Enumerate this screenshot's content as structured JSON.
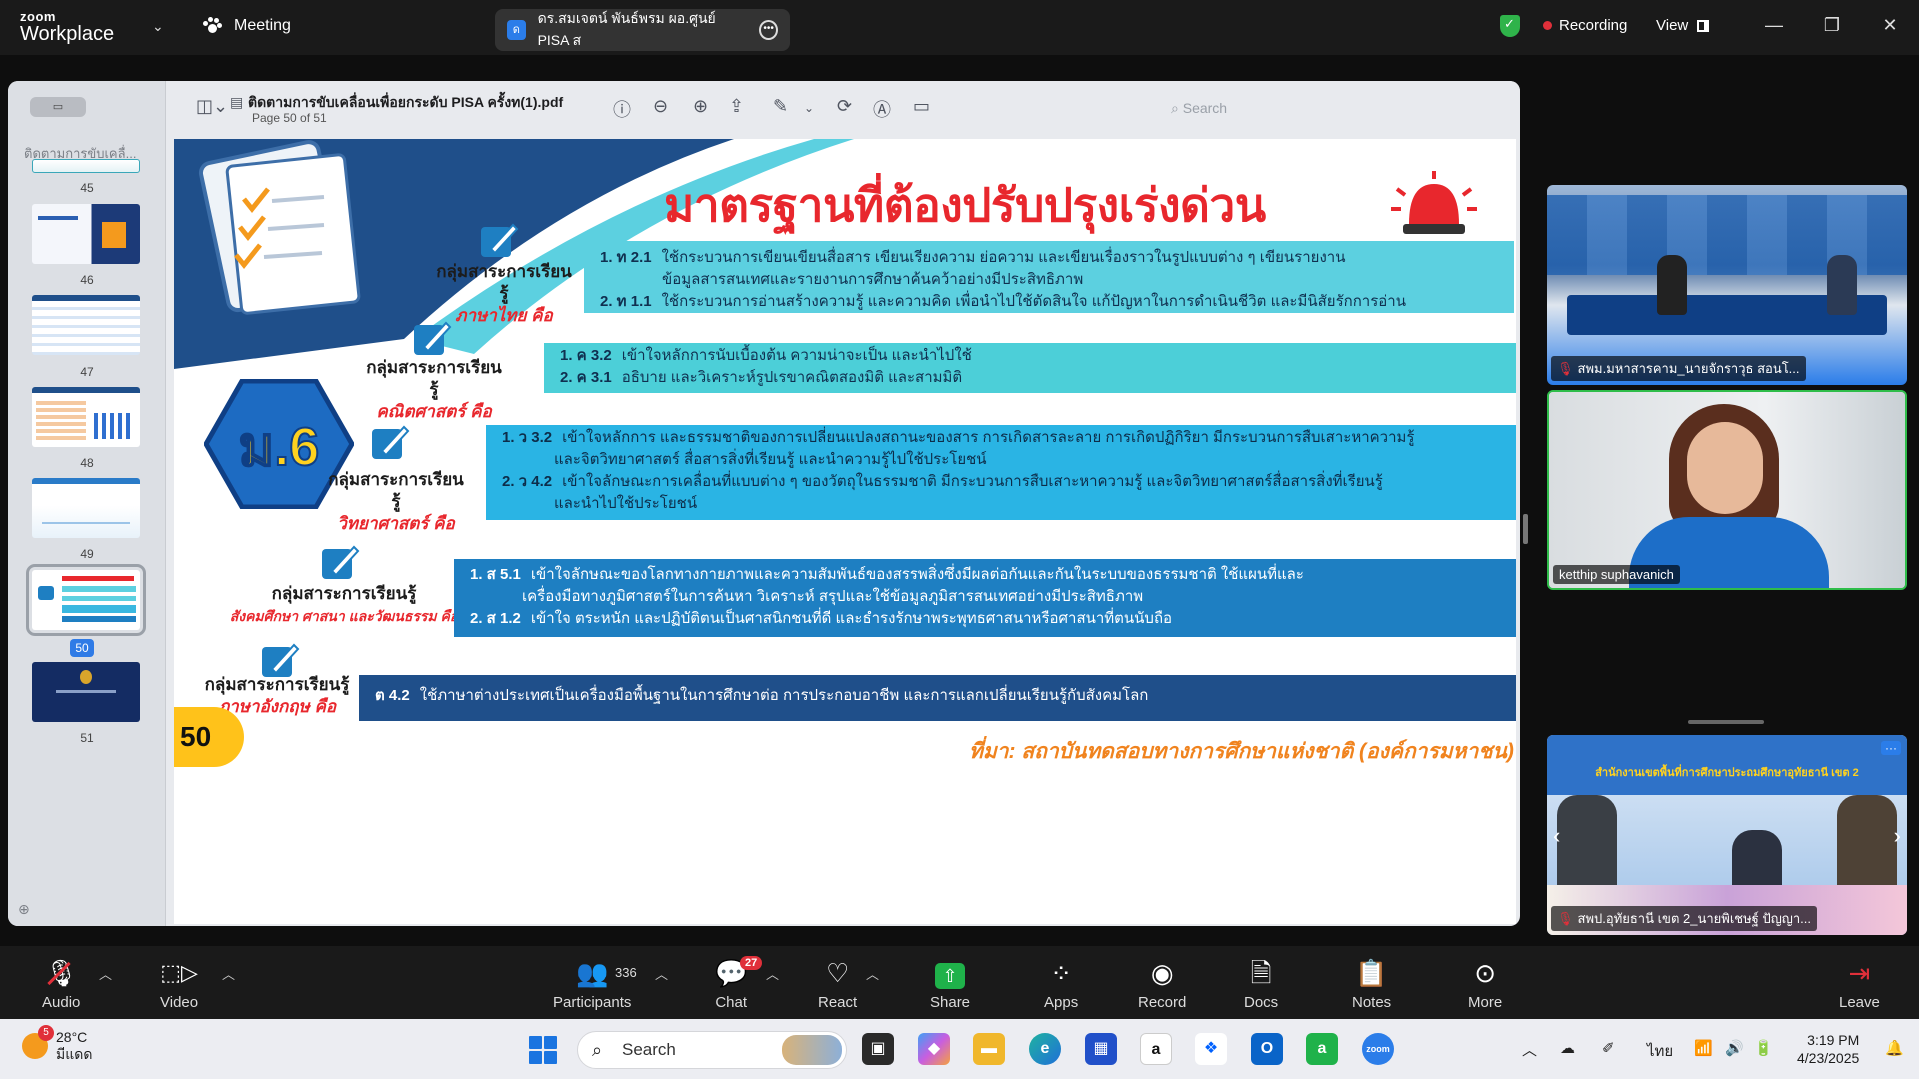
{
  "titlebar": {
    "brand_top": "zoom",
    "brand_bottom": "Workplace",
    "meeting_label": "Meeting",
    "share_badge": "ด",
    "share_title": "ดร.สมเจตน์ พันธ์พรม ผอ.ศูนย์ PISA ส",
    "recording_label": "Recording",
    "view_label": "View",
    "minimize": "—",
    "restore": "❐",
    "close": "✕"
  },
  "viewer": {
    "sidebar_title": "ติดตามการขับเคลื่...",
    "sidebar_add": "⊕",
    "thumbnails": [
      {
        "page": "45"
      },
      {
        "page": "46"
      },
      {
        "page": "47"
      },
      {
        "page": "48"
      },
      {
        "page": "49"
      },
      {
        "page": "50"
      },
      {
        "page": "51"
      }
    ],
    "file_name": "ติดตามการขับเคลื่อนเพื่อยกระดับ PISA ครั้งท(1).pdf",
    "page_info": "Page 50 of 51",
    "search_placeholder": "Search"
  },
  "slide": {
    "title": "มาตรฐานที่ต้องปรับปรุงเร่งด่วน",
    "grade": "ม.6",
    "page_number": "50",
    "source": "ที่มา: สถาบันทดสอบทางการศึกษาแห่งชาติ (องค์การมหาชน)",
    "subjects": [
      {
        "name": "กลุ่มสาระการเรียนรู้",
        "area": "ภาษาไทย คือ",
        "items": [
          {
            "code": "1. ท 2.1",
            "text": "ใช้กระบวนการเขียนเขียนสื่อสาร เขียนเรียงความ ย่อความ และเขียนเรื่องราวในรูปแบบต่าง ๆ เขียนรายงาน"
          },
          {
            "code": "",
            "text": "ข้อมูลสารสนเทศและรายงานการศึกษาค้นคว้าอย่างมีประสิทธิภาพ"
          },
          {
            "code": "2. ท 1.1",
            "text": "ใช้กระบวนการอ่านสร้างความรู้ และความคิด เพื่อนำไปใช้ตัดสินใจ แก้ปัญหาในการดำเนินชีวิต และมีนิสัยรักการอ่าน"
          }
        ]
      },
      {
        "name": "กลุ่มสาระการเรียนรู้",
        "area": "คณิตศาสตร์ คือ",
        "items": [
          {
            "code": "1. ค 3.2",
            "text": "เข้าใจหลักการนับเบื้องต้น ความน่าจะเป็น และนำไปใช้"
          },
          {
            "code": "2. ค 3.1",
            "text": "อธิบาย และวิเคราะห์รูปเรขาคณิตสองมิติ และสามมิติ"
          }
        ]
      },
      {
        "name": "กลุ่มสาระการเรียนรู้",
        "area": "วิทยาศาสตร์ คือ",
        "items": [
          {
            "code": "1. ว 3.2",
            "text": "เข้าใจหลักการ และธรรมชาติของการเปลี่ยนแปลงสถานะของสาร การเกิดสารละลาย การเกิดปฏิกิริยา มีกระบวนการสืบเสาะหาความรู้"
          },
          {
            "code": "",
            "text": "และจิตวิทยาศาสตร์ สื่อสารสิ่งที่เรียนรู้ และนำความรู้ไปใช้ประโยชน์"
          },
          {
            "code": "2. ว 4.2",
            "text": "เข้าใจลักษณะการเคลื่อนที่แบบต่าง ๆ ของวัตถุในธรรมชาติ มีกระบวนการสืบเสาะหาความรู้ และจิตวิทยาศาสตร์สื่อสารสิ่งที่เรียนรู้"
          },
          {
            "code": "",
            "text": "และนำไปใช้ประโยชน์"
          }
        ]
      },
      {
        "name": "กลุ่มสาระการเรียนรู้",
        "area": "สังคมศึกษา ศาสนา และวัฒนธรรม คือ",
        "items": [
          {
            "code": "1. ส 5.1",
            "text": "เข้าใจลักษณะของโลกทางกายภาพและความสัมพันธ์ของสรรพสิ่งซึ่งมีผลต่อกันและกันในระบบของธรรมชาติ ใช้แผนที่และ"
          },
          {
            "code": "",
            "text": "เครื่องมือทางภูมิศาสตร์ในการค้นหา วิเคราะห์ สรุปและใช้ข้อมูลภูมิสารสนเทศอย่างมีประสิทธิภาพ"
          },
          {
            "code": "2. ส 1.2",
            "text": "เข้าใจ ตระหนัก และปฏิบัติตนเป็นศาสนิกชนที่ดี และธำรงรักษาพระพุทธศาสนาหรือศาสนาที่ตนนับถือ"
          }
        ]
      },
      {
        "name": "กลุ่มสาระการเรียนรู้",
        "area": "ภาษาอังกฤษ คือ",
        "items": [
          {
            "code": "ต 4.2",
            "text": "ใช้ภาษาต่างประเทศเป็นเครื่องมือพื้นฐานในการศึกษาต่อ การประกอบอาชีพ และการแลกเปลี่ยนเรียนรู้กับสังคมโลก"
          }
        ]
      }
    ]
  },
  "participants_video": [
    {
      "name": "สพม.มหาสารคาม_นายจักราวุธ สอนโ..."
    },
    {
      "name": "ketthip suphavanich"
    },
    {
      "name": "สพป.อุทัยธานี เขต 2_นายพิเชษฐ์ ปัญญา..."
    }
  ],
  "tile3_banner": "สำนักงานเขตพื้นที่การศึกษาประถมศึกษาอุทัยธานี เขต 2",
  "meetbar": {
    "audio": "Audio",
    "video": "Video",
    "participants": "Participants",
    "participants_count": "336",
    "chat": "Chat",
    "chat_badge": "27",
    "react": "React",
    "share": "Share",
    "apps": "Apps",
    "record": "Record",
    "docs": "Docs",
    "notes": "Notes",
    "more": "More",
    "leave": "Leave"
  },
  "taskbar": {
    "weather_badge": "5",
    "temp": "28°C",
    "weather_desc": "มีแดด",
    "search_placeholder": "Search",
    "lang": "ไทย",
    "time": "3:19 PM",
    "date": "4/23/2025"
  },
  "colors": {
    "zoom_blue": "#2b7de9",
    "recording_red": "#e0303a",
    "share_green": "#1fb24a",
    "slide_title_red": "#e8272d",
    "band_cyan": "#5cd0e0",
    "band_blue": "#1e7fc2",
    "band_navy": "#1f4f8a",
    "source_orange": "#f0831e"
  }
}
